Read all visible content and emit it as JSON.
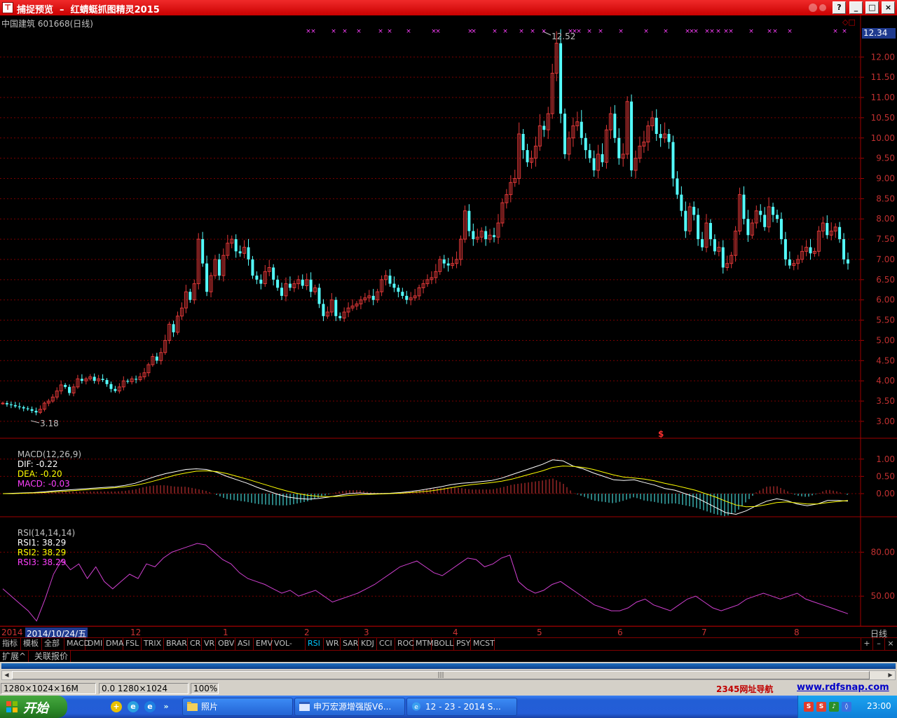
{
  "window": {
    "title": "捕捉预览  –  红蜻蜓抓图精灵2015",
    "icon_name": "screenshot-app-icon",
    "buttons": {
      "help": "?",
      "minimize": "_",
      "maximize": "□",
      "close": "×"
    }
  },
  "stock": {
    "header": "中国建筑 601668(日线)",
    "current_price_tag": "12.34",
    "high_label": "12.52",
    "low_label": "3.18",
    "signal_mark": "$",
    "corner_icons": "◇□"
  },
  "macd_header": {
    "name": "MACD(12,26,9)",
    "dif": "DIF: -0.22",
    "dea": "DEA: -0.20",
    "macd": "MACD: -0.03"
  },
  "rsi_header": {
    "name": "RSI(14,14,14)",
    "rsi1": "RSI1: 38.29",
    "rsi2": "RSI2: 38.29",
    "rsi3": "RSI3: 38.29"
  },
  "datebar": {
    "left": "2014",
    "cursor": "2014/10/24/五",
    "months": [
      "12",
      "1",
      "2",
      "3",
      "4",
      "5",
      "6",
      "7",
      "8"
    ],
    "period": "日线"
  },
  "tabs": [
    "指标",
    "模板",
    "全部",
    "MACD",
    "DMI",
    "DMA",
    "FSL",
    "TRIX",
    "BRAR",
    "CR",
    "VR",
    "OBV",
    "ASI",
    "EMV",
    "VOL-TDX",
    "RSI",
    "WR",
    "SAR",
    "KDJ",
    "CCI",
    "ROC",
    "MTM",
    "BOLL",
    "PSY",
    "MCST"
  ],
  "selected_tab": "RSI",
  "zoom_buttons": {
    "plus": "+",
    "minus": "–",
    "close": "×"
  },
  "panel_tabs": [
    "扩展^",
    "关联报价"
  ],
  "status": {
    "size": "1280×1024×16M",
    "coords": "0.0 1280×1024",
    "zoom": "100%",
    "ad1": "2345网址导航",
    "ad2": "www.rdfsnap.com"
  },
  "taskbar": {
    "start": "开始",
    "tasks": [
      {
        "label": "照片",
        "icon": "folder-icon"
      },
      {
        "label": "申万宏源增强版V6...",
        "icon": "app-window-icon"
      },
      {
        "label": "12 - 23 - 2014 S...",
        "icon": "ie-icon"
      }
    ],
    "clock": "23:00"
  },
  "colors": {
    "up": "#e03838",
    "down": "#54ffff",
    "grid": "#7a0000",
    "axis": "#a00000",
    "dif": "#ffffff",
    "dea": "#ffff00",
    "rsi": "#d040d0",
    "macd_text": "#ff40ff",
    "marker": "#ff40ff"
  },
  "chart_data": [
    {
      "type": "candlestick",
      "title": "中国建筑 601668(日线)",
      "y_ticks": [
        12.0,
        11.5,
        11.0,
        10.5,
        10.0,
        9.5,
        9.0,
        8.5,
        8.0,
        7.5,
        7.0,
        6.5,
        6.0,
        5.5,
        5.0,
        4.5,
        4.0,
        3.5,
        3.0
      ],
      "ylim": [
        2.6,
        12.75
      ],
      "close": [
        3.45,
        3.42,
        3.4,
        3.37,
        3.35,
        3.32,
        3.3,
        3.26,
        3.22,
        3.3,
        3.45,
        3.5,
        3.6,
        3.75,
        3.9,
        3.85,
        3.7,
        3.85,
        4.05,
        4.0,
        4.05,
        4.1,
        4.0,
        4.05,
        4.02,
        3.92,
        3.8,
        3.75,
        3.85,
        4.0,
        3.98,
        4.05,
        4.03,
        4.1,
        4.2,
        4.4,
        4.6,
        4.5,
        4.7,
        5.0,
        5.4,
        5.2,
        5.6,
        5.8,
        6.2,
        6.0,
        6.4,
        7.5,
        6.9,
        6.2,
        6.6,
        7.0,
        6.6,
        7.1,
        7.4,
        7.5,
        7.2,
        7.15,
        7.3,
        7.0,
        6.6,
        6.5,
        6.4,
        6.7,
        6.8,
        6.5,
        6.3,
        6.1,
        6.4,
        6.3,
        6.4,
        6.5,
        6.35,
        6.5,
        6.2,
        6.3,
        5.9,
        5.6,
        5.7,
        6.0,
        5.6,
        5.55,
        5.7,
        5.8,
        5.85,
        5.9,
        6.0,
        6.05,
        6.1,
        6.0,
        6.2,
        6.5,
        6.6,
        6.4,
        6.3,
        6.2,
        6.1,
        6.0,
        6.05,
        6.1,
        6.3,
        6.4,
        6.5,
        6.55,
        6.7,
        7.0,
        6.9,
        6.85,
        6.9,
        7.0,
        7.5,
        8.2,
        7.7,
        7.5,
        7.55,
        7.7,
        7.5,
        7.6,
        7.55,
        7.9,
        8.4,
        8.6,
        8.9,
        9.0,
        10.1,
        9.7,
        9.4,
        9.5,
        9.8,
        10.3,
        10.2,
        10.6,
        11.6,
        12.34,
        10.6,
        9.6,
        10.0,
        10.3,
        10.4,
        10.0,
        9.7,
        9.5,
        9.2,
        9.6,
        9.4,
        10.2,
        10.6,
        10.0,
        9.5,
        9.6,
        10.9,
        9.2,
        9.5,
        9.8,
        9.9,
        10.3,
        10.5,
        10.1,
        10.0,
        10.1,
        9.9,
        9.0,
        8.6,
        8.2,
        7.7,
        8.3,
        8.1,
        7.5,
        7.3,
        7.9,
        7.5,
        7.2,
        7.3,
        6.8,
        6.9,
        7.1,
        7.7,
        8.6,
        8.0,
        7.6,
        7.9,
        8.2,
        8.1,
        7.8,
        8.3,
        8.1,
        8.0,
        7.5,
        7.0,
        6.85,
        6.9,
        7.0,
        7.2,
        7.3,
        7.15,
        7.2,
        7.7,
        7.9,
        7.6,
        7.7,
        7.8,
        7.5,
        7.0,
        6.9
      ]
    },
    {
      "type": "line",
      "title": "MACD(12,26,9)",
      "y_ticks": [
        1.0,
        0.5,
        0.0
      ],
      "ylim": [
        -0.65,
        1.3
      ],
      "series": [
        {
          "name": "DIF",
          "values": [
            0.0,
            0.01,
            0.02,
            0.03,
            0.05,
            0.08,
            0.1,
            0.12,
            0.14,
            0.16,
            0.18,
            0.2,
            0.24,
            0.3,
            0.4,
            0.5,
            0.58,
            0.64,
            0.7,
            0.72,
            0.7,
            0.62,
            0.5,
            0.4,
            0.3,
            0.18,
            0.08,
            -0.02,
            -0.1,
            -0.14,
            -0.16,
            -0.14,
            -0.1,
            -0.05,
            0.0,
            0.02,
            0.0,
            0.0,
            0.01,
            0.03,
            0.06,
            0.1,
            0.15,
            0.2,
            0.26,
            0.3,
            0.32,
            0.35,
            0.38,
            0.45,
            0.55,
            0.65,
            0.75,
            0.85,
            0.98,
            0.95,
            0.8,
            0.72,
            0.6,
            0.5,
            0.4,
            0.38,
            0.4,
            0.32,
            0.25,
            0.15,
            0.1,
            0.0,
            -0.1,
            -0.25,
            -0.4,
            -0.55,
            -0.6,
            -0.5,
            -0.35,
            -0.22,
            -0.15,
            -0.2,
            -0.3,
            -0.35,
            -0.3,
            -0.2,
            -0.2,
            -0.22
          ]
        },
        {
          "name": "DEA",
          "values": [
            0.0,
            0.0,
            0.01,
            0.02,
            0.03,
            0.05,
            0.07,
            0.09,
            0.11,
            0.13,
            0.15,
            0.17,
            0.2,
            0.24,
            0.3,
            0.38,
            0.46,
            0.54,
            0.6,
            0.65,
            0.66,
            0.64,
            0.58,
            0.5,
            0.42,
            0.33,
            0.24,
            0.15,
            0.07,
            0.0,
            -0.05,
            -0.08,
            -0.09,
            -0.08,
            -0.05,
            -0.03,
            -0.02,
            -0.01,
            0.0,
            0.01,
            0.03,
            0.05,
            0.08,
            0.12,
            0.17,
            0.22,
            0.26,
            0.29,
            0.32,
            0.36,
            0.42,
            0.5,
            0.58,
            0.66,
            0.76,
            0.8,
            0.79,
            0.76,
            0.7,
            0.62,
            0.54,
            0.48,
            0.45,
            0.42,
            0.37,
            0.3,
            0.24,
            0.17,
            0.1,
            0.0,
            -0.1,
            -0.22,
            -0.33,
            -0.38,
            -0.37,
            -0.32,
            -0.26,
            -0.24,
            -0.27,
            -0.3,
            -0.3,
            -0.26,
            -0.23,
            -0.2
          ]
        }
      ]
    },
    {
      "type": "line",
      "title": "RSI(14,14,14)",
      "y_ticks": [
        80.0,
        50.0
      ],
      "ylim": [
        30,
        97
      ],
      "series": [
        {
          "name": "RSI",
          "values": [
            55,
            50,
            45,
            40,
            33,
            48,
            65,
            75,
            68,
            72,
            62,
            70,
            60,
            55,
            60,
            65,
            62,
            72,
            70,
            76,
            80,
            82,
            84,
            86,
            85,
            80,
            75,
            72,
            66,
            62,
            60,
            58,
            55,
            52,
            54,
            50,
            52,
            54,
            50,
            46,
            48,
            50,
            52,
            55,
            58,
            62,
            66,
            70,
            72,
            74,
            70,
            66,
            64,
            68,
            72,
            76,
            75,
            70,
            72,
            76,
            78,
            60,
            55,
            52,
            54,
            58,
            60,
            56,
            52,
            48,
            44,
            42,
            40,
            40,
            42,
            46,
            48,
            44,
            42,
            40,
            44,
            48,
            50,
            46,
            42,
            40,
            42,
            44,
            48,
            50,
            52,
            50,
            48,
            50,
            52,
            48,
            46,
            44,
            42,
            40,
            38
          ]
        }
      ]
    }
  ]
}
